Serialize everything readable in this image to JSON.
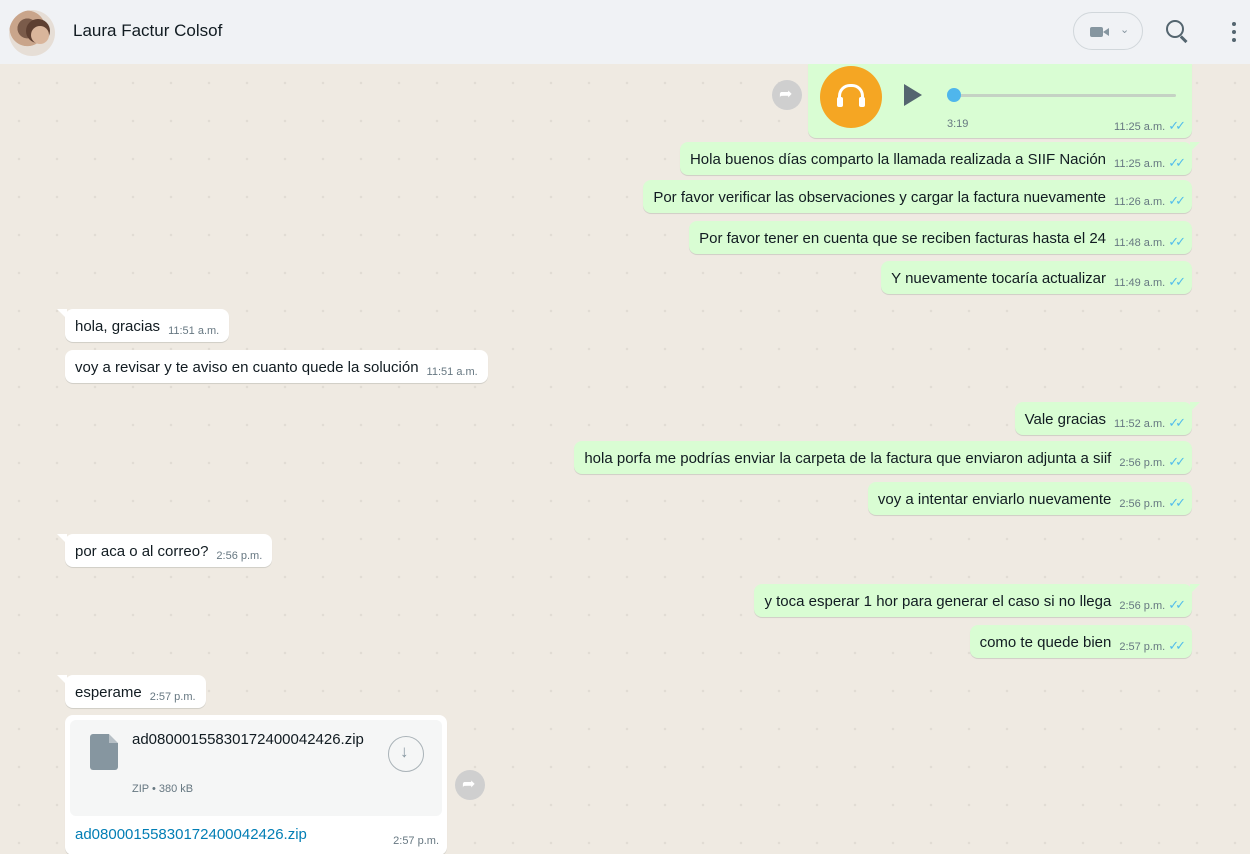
{
  "header": {
    "contact_name": "Laura Factur Colsof",
    "video_icon": "video-camera-icon",
    "search_icon": "search-icon",
    "menu_icon": "kebab-menu-icon"
  },
  "voice_message": {
    "duration": "3:19",
    "time": "11:25 a.m.",
    "progress": 0.0
  },
  "messages": [
    {
      "dir": "out",
      "text": "Hola buenos días comparto la llamada realizada a SIIF Nación",
      "time": "11:25 a.m."
    },
    {
      "dir": "out",
      "text": "Por favor verificar las observaciones y cargar la factura nuevamente",
      "time": "11:26 a.m."
    },
    {
      "dir": "out",
      "text": "Por favor tener en cuenta que se reciben facturas hasta el 24",
      "time": "11:48 a.m."
    },
    {
      "dir": "out",
      "text": "Y nuevamente tocaría actualizar",
      "time": "11:49 a.m."
    },
    {
      "dir": "in",
      "text": "hola, gracias",
      "time": "11:51 a.m."
    },
    {
      "dir": "in",
      "text": "voy a revisar y te aviso en cuanto quede la solución",
      "time": "11:51 a.m."
    },
    {
      "dir": "out",
      "text": "Vale gracias",
      "time": "11:52 a.m."
    },
    {
      "dir": "out",
      "text": "hola porfa me podrías enviar la carpeta de la factura que enviaron adjunta a siif",
      "time": "2:56 p.m."
    },
    {
      "dir": "out",
      "text": "voy a intentar enviarlo nuevamente",
      "time": "2:56 p.m."
    },
    {
      "dir": "in",
      "text": "por aca o al correo?",
      "time": "2:56 p.m."
    },
    {
      "dir": "out",
      "text": "y toca esperar 1 hor para generar el caso si no llega",
      "time": "2:56 p.m."
    },
    {
      "dir": "out",
      "text": "como te quede bien",
      "time": "2:57 p.m."
    },
    {
      "dir": "in",
      "text": "esperame",
      "time": "2:57 p.m."
    }
  ],
  "file_message": {
    "file_name": "ad08000155830172400042426.zip",
    "file_info": "ZIP • 380 kB",
    "link_text": "ad08000155830172400042426.zip",
    "time": "2:57 p.m."
  },
  "colors": {
    "outgoing_bubble": "#d9fdd3",
    "incoming_bubble": "#ffffff",
    "read_ticks": "#53bdeb",
    "chat_background": "#efeae2"
  }
}
